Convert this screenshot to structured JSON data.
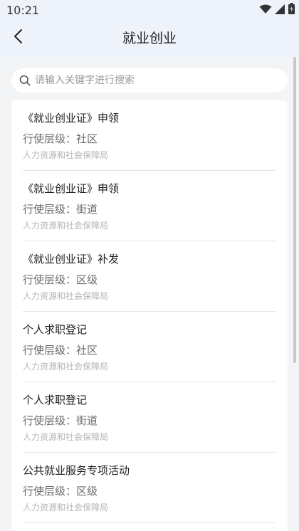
{
  "status_bar": {
    "time": "10:21",
    "icons": [
      "wifi-icon",
      "cellular-signal-icon",
      "battery-icon"
    ]
  },
  "nav": {
    "title": "就业创业",
    "back_icon": "back-arrow-icon"
  },
  "search": {
    "placeholder": "请输入关键字进行搜索",
    "value": "",
    "icon": "search-icon"
  },
  "items": [
    {
      "title": "《就业创业证》申领",
      "level_label": "行使层级：",
      "level": "社区",
      "dept": "人力资源和社会保障局"
    },
    {
      "title": "《就业创业证》申领",
      "level_label": "行使层级：",
      "level": "街道",
      "dept": "人力资源和社会保障局"
    },
    {
      "title": "《就业创业证》补发",
      "level_label": "行使层级：",
      "level": "区级",
      "dept": "人力资源和社会保障局"
    },
    {
      "title": "个人求职登记",
      "level_label": "行使层级：",
      "level": "社区",
      "dept": "人力资源和社会保障局"
    },
    {
      "title": "个人求职登记",
      "level_label": "行使层级：",
      "level": "街道",
      "dept": "人力资源和社会保障局"
    },
    {
      "title": "公共就业服务专项活动",
      "level_label": "行使层级：",
      "level": "区级",
      "dept": "人力资源和社会保障局"
    }
  ],
  "colors": {
    "header_bg": "#eef3fb",
    "page_bg": "#f3f4f6",
    "card_bg": "#ffffff",
    "secondary_text": "#6b6b6b",
    "tertiary_text": "#b4b4b4"
  }
}
